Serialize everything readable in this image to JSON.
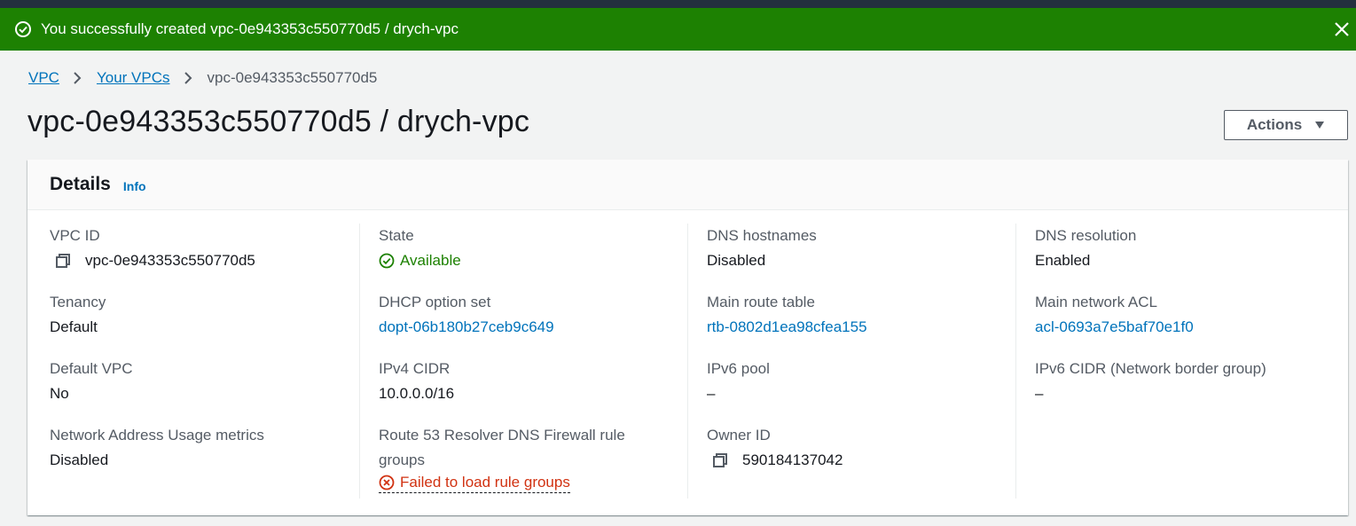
{
  "flash": {
    "message": "You successfully created vpc-0e943353c550770d5 / drych-vpc",
    "bg_color": "#1d8102"
  },
  "breadcrumb": {
    "items": [
      "VPC",
      "Your VPCs"
    ],
    "current": "vpc-0e943353c550770d5"
  },
  "page": {
    "title": "vpc-0e943353c550770d5 / drych-vpc",
    "actions_label": "Actions"
  },
  "details": {
    "heading": "Details",
    "info_label": "Info",
    "col1": {
      "vpc_id_label": "VPC ID",
      "vpc_id": "vpc-0e943353c550770d5",
      "tenancy_label": "Tenancy",
      "tenancy": "Default",
      "default_vpc_label": "Default VPC",
      "default_vpc": "No",
      "nau_label": "Network Address Usage metrics",
      "nau": "Disabled"
    },
    "col2": {
      "state_label": "State",
      "state": "Available",
      "dhcp_label": "DHCP option set",
      "dhcp": "dopt-06b180b27ceb9c649",
      "ipv4_label": "IPv4 CIDR",
      "ipv4": "10.0.0.0/16",
      "r53_label_1": "Route 53 Resolver DNS Firewall rule",
      "r53_label_2": "groups",
      "r53_error": "Failed to load rule groups"
    },
    "col3": {
      "dns_hostnames_label": "DNS hostnames",
      "dns_hostnames": "Disabled",
      "main_rt_label": "Main route table",
      "main_rt": "rtb-0802d1ea98cfea155",
      "ipv6_pool_label": "IPv6 pool",
      "ipv6_pool": "–",
      "owner_label": "Owner ID",
      "owner": "590184137042"
    },
    "col4": {
      "dns_res_label": "DNS resolution",
      "dns_res": "Enabled",
      "acl_label": "Main network ACL",
      "acl": "acl-0693a7e5baf70e1f0",
      "ipv6_cidr_label": "IPv6 CIDR (Network border group)",
      "ipv6_cidr": "–"
    }
  },
  "icons": {
    "flash": "check-circle-icon",
    "close": "close-icon",
    "copy": "copy-icon",
    "state": "check-circle-icon",
    "error": "error-circle-icon",
    "caret": "caret-down-icon"
  }
}
